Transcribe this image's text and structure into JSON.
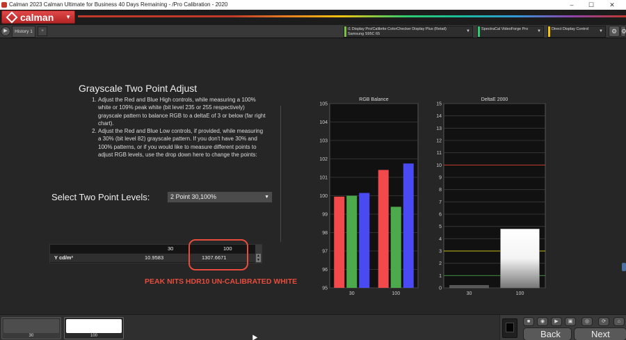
{
  "window": {
    "title": "Calman 2023 Calman Ultimate for Business 40 Days Remaining  - /Pro Calibration - 2020",
    "controls": [
      "–",
      "☐",
      "✕"
    ]
  },
  "header": {
    "logo_text": "calman",
    "logo_caret": "▼"
  },
  "tabbar": {
    "back_icon": "▶",
    "history_tab": "History 1",
    "add_tab": "+",
    "devices": [
      {
        "line1": "i1 Display Pro/Calibrite ColorChecker Display Plus (Retail)",
        "line2": "Samsung S95C 65",
        "color": "#7dc242"
      },
      {
        "line1": "SpectraCal VideoForge Pro",
        "line2": "",
        "color": "#2ecc71"
      },
      {
        "line1": "Direct Display Control",
        "line2": "",
        "color": "#f1c40f"
      }
    ],
    "caret": "▼",
    "settings_icon": "⚙",
    "more_icon": "⚙"
  },
  "content": {
    "heading": "Grayscale Two Point Adjust",
    "instructions": [
      "Adjust the Red and Blue High controls, while measuring a 100% white or 109% peak white (bit level 235 or 255 respectively) grayscale pattern to balance RGB to a deltaE of 3 or below (far right chart).",
      "Adjust the Red and Blue Low controls, if provided, while measuring a 30% (bit level 82) grayscale pattern. If you don't have 30% and 100% patterns, or if you would like to measure different points to adjust RGB levels, use the drop down here to change the points:"
    ],
    "select_label": "Select Two Point Levels:",
    "select_value": "2 Point 30,100%",
    "select_caret": "▼"
  },
  "table": {
    "columns": [
      "",
      "30",
      "100"
    ],
    "rows": [
      {
        "label": "Y cd/m²",
        "values": [
          "10.9583",
          "1307.6671"
        ]
      }
    ],
    "scroll_up": "▲",
    "scroll_down": "▼"
  },
  "annotation": "PEAK NITS HDR10 UN-CALIBRATED WHITE",
  "chart_data": [
    {
      "type": "bar",
      "title": "RGB Balance",
      "categories": [
        "30",
        "100"
      ],
      "series": [
        {
          "color": "#f24a4a",
          "values": [
            99.95,
            101.4
          ]
        },
        {
          "color": "#4caa4c",
          "values": [
            100.0,
            99.4
          ]
        },
        {
          "color": "#4a4af2",
          "values": [
            100.15,
            101.75
          ]
        }
      ],
      "ylim": [
        95,
        105
      ],
      "yticks": [
        "95",
        "96",
        "97",
        "98",
        "99",
        "100",
        "101",
        "102",
        "103",
        "104",
        "105"
      ],
      "grid": true
    },
    {
      "type": "bar",
      "title": "DeltaE 2000",
      "categories": [
        "30",
        "100"
      ],
      "values": [
        0.2,
        4.8
      ],
      "ylim": [
        0,
        15
      ],
      "yticks": [
        "0",
        "1",
        "2",
        "3",
        "4",
        "5",
        "6",
        "7",
        "8",
        "9",
        "10",
        "11",
        "12",
        "13",
        "14",
        "15"
      ],
      "reference_lines": [
        {
          "value": 10,
          "color": "#c0392b"
        },
        {
          "value": 3,
          "color": "#c9c01a"
        },
        {
          "value": 1,
          "color": "#3a8a3a"
        }
      ],
      "grid": true
    }
  ],
  "bottom": {
    "swatches": [
      {
        "label": "30",
        "color": "#4d4d4d"
      },
      {
        "label": "100",
        "color": "#ffffff"
      }
    ],
    "nav_icons": [
      "■",
      "◉",
      "▶",
      "▣",
      "◎",
      "⟳",
      "⌂"
    ],
    "back_label": "Back",
    "next_label": "Next"
  }
}
